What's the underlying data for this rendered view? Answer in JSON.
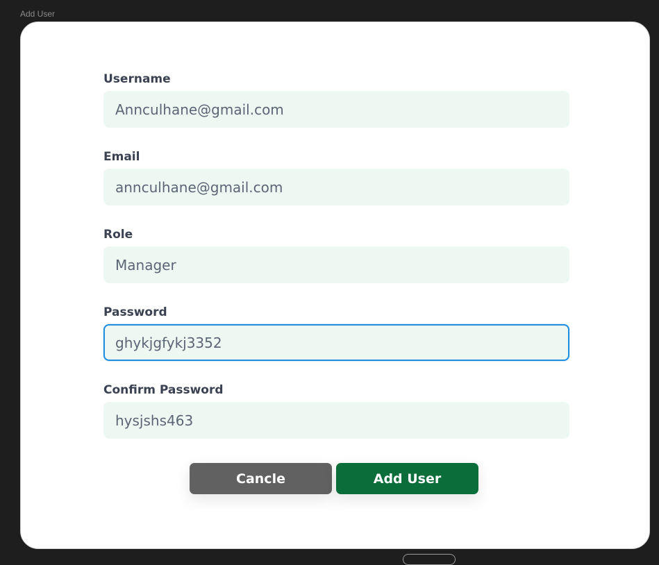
{
  "frame": {
    "label": "Add User"
  },
  "form": {
    "fields": [
      {
        "label": "Username",
        "value": "Annculhane@gmail.com"
      },
      {
        "label": "Email",
        "value": "annculhane@gmail.com"
      },
      {
        "label": "Role",
        "value": "Manager"
      },
      {
        "label": "Password",
        "value": "ghykjgfykj3352"
      },
      {
        "label": "Confirm Password",
        "value": "hysjshs463"
      }
    ],
    "focused_field": "Password"
  },
  "actions": {
    "cancel_label": "Cancle",
    "add_label": "Add User"
  },
  "colors": {
    "background": "#1e1e1e",
    "modal": "#ffffff",
    "input_bg": "#eef8f2",
    "focus_border": "#1f8de0",
    "cancel_bg": "#616161",
    "add_bg": "#0b6d3a"
  }
}
